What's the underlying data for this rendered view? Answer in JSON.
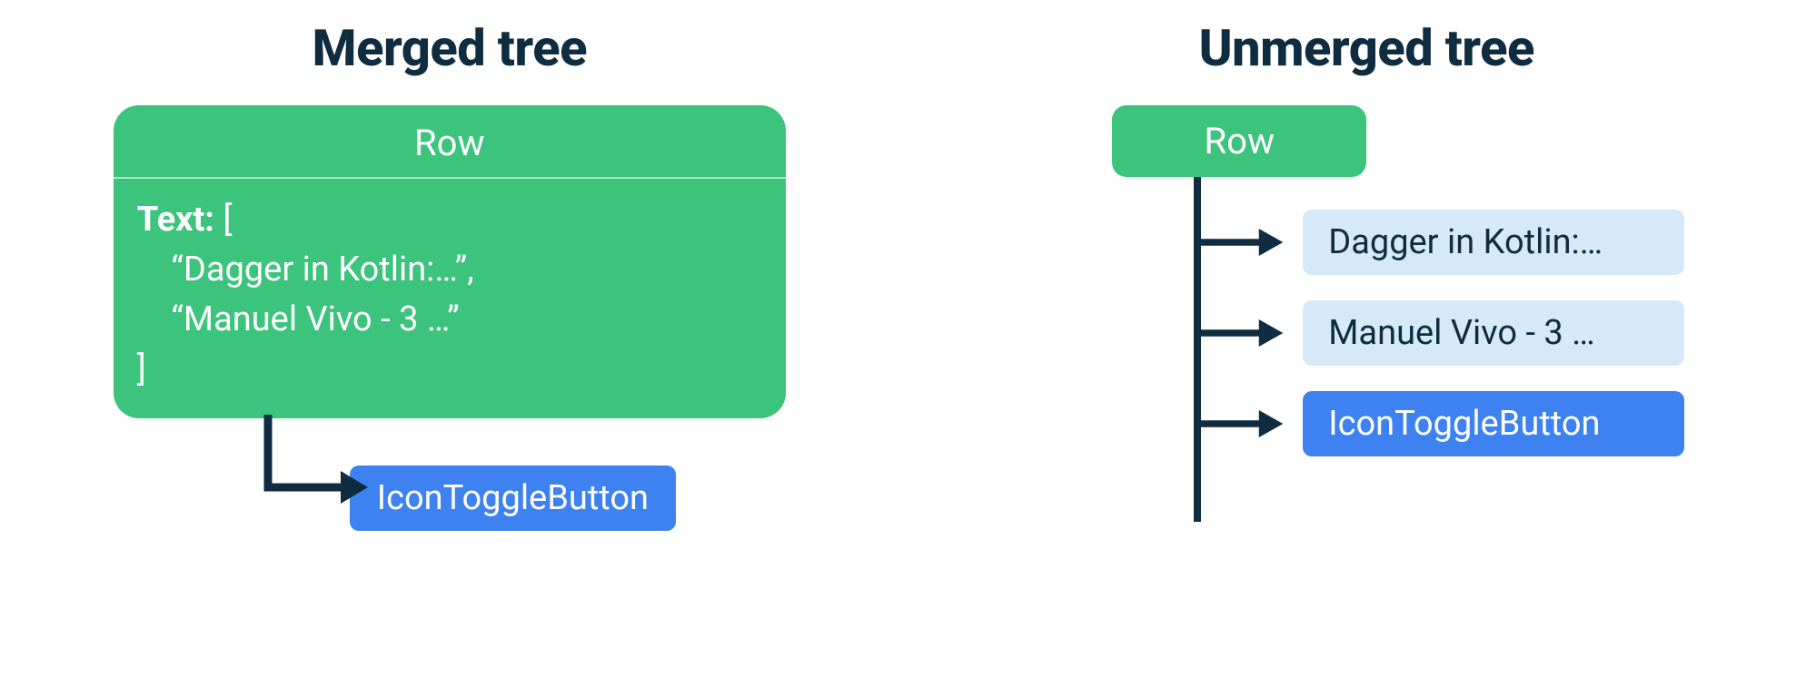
{
  "merged": {
    "title": "Merged tree",
    "root_label": "Row",
    "text_label": "Text:",
    "text_open": " [",
    "text_line1": "    “Dagger in Kotlin:…”,",
    "text_line2": "    “Manuel Vivo - 3 …”",
    "text_close": "]",
    "child_label": "IconToggleButton"
  },
  "unmerged": {
    "title": "Unmerged tree",
    "root_label": "Row",
    "children": {
      "c1": "Dagger in Kotlin:…",
      "c2": "Manuel Vivo - 3 …",
      "c3": "IconToggleButton"
    }
  },
  "colors": {
    "green": "#3cc47c",
    "blue": "#3d82f0",
    "lightblue": "#d6e9f8",
    "dark": "#0f2c41"
  }
}
